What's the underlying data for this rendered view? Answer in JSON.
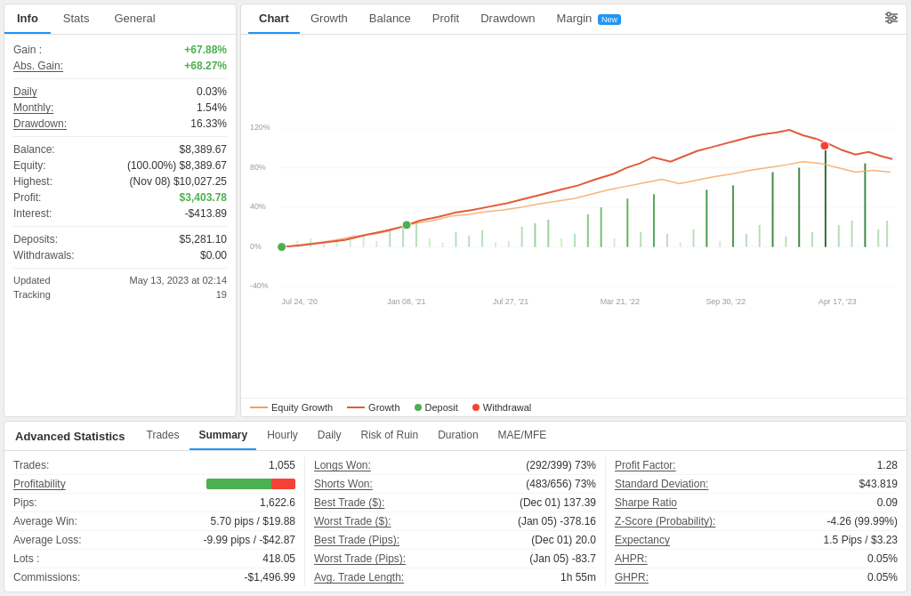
{
  "left": {
    "tabs": [
      "Info",
      "Stats",
      "General"
    ],
    "active_tab": "Info",
    "gain_label": "Gain :",
    "gain_value": "+67.88%",
    "abs_gain_label": "Abs. Gain:",
    "abs_gain_value": "+68.27%",
    "daily_label": "Daily",
    "daily_value": "0.03%",
    "monthly_label": "Monthly:",
    "monthly_value": "1.54%",
    "drawdown_label": "Drawdown:",
    "drawdown_value": "16.33%",
    "balance_label": "Balance:",
    "balance_value": "$8,389.67",
    "equity_label": "Equity:",
    "equity_value": "(100.00%) $8,389.67",
    "highest_label": "Highest:",
    "highest_value": "(Nov 08) $10,027.25",
    "profit_label": "Profit:",
    "profit_value": "$3,403.78",
    "interest_label": "Interest:",
    "interest_value": "-$413.89",
    "deposits_label": "Deposits:",
    "deposits_value": "$5,281.10",
    "withdrawals_label": "Withdrawals:",
    "withdrawals_value": "$0.00",
    "updated_label": "Updated",
    "updated_value": "May 13, 2023 at 02:14",
    "tracking_label": "Tracking",
    "tracking_value": "19"
  },
  "chart": {
    "tabs": [
      "Chart",
      "Growth",
      "Balance",
      "Profit",
      "Drawdown",
      "Margin"
    ],
    "active_tab": "Chart",
    "margin_badge": "New",
    "y_labels": [
      "120%",
      "80%",
      "40%",
      "0%",
      "-40%"
    ],
    "x_labels": [
      "Jul 24, '20",
      "Jan 08, '21",
      "Jul 27, '21",
      "Mar 21, '22",
      "Sep 30, '22",
      "Apr 17, '23"
    ],
    "legend": [
      {
        "label": "Equity Growth",
        "type": "line",
        "color": "#f4a259"
      },
      {
        "label": "Growth",
        "type": "line",
        "color": "#e05c3a"
      },
      {
        "label": "Deposit",
        "type": "dot",
        "color": "#4CAF50"
      },
      {
        "label": "Withdrawal",
        "type": "dot",
        "color": "#f44336"
      }
    ]
  },
  "advanced": {
    "title": "Advanced Statistics",
    "tabs": [
      "Trades",
      "Summary",
      "Hourly",
      "Daily",
      "Risk of Ruin",
      "Duration",
      "MAE/MFE"
    ],
    "active_tab": "Summary",
    "col1": [
      {
        "label": "Trades:",
        "value": "1,055",
        "ul": false
      },
      {
        "label": "Profitability",
        "value": "bar",
        "ul": true
      },
      {
        "label": "Pips:",
        "value": "1,622.6",
        "ul": false
      },
      {
        "label": "Average Win:",
        "value": "5.70 pips / $19.88",
        "ul": false
      },
      {
        "label": "Average Loss:",
        "value": "-9.99 pips / -$42.87",
        "ul": false
      },
      {
        "label": "Lots :",
        "value": "418.05",
        "ul": false
      },
      {
        "label": "Commissions:",
        "value": "-$1,496.99",
        "ul": false
      }
    ],
    "col2": [
      {
        "label": "Longs Won:",
        "value": "(292/399) 73%",
        "ul": true
      },
      {
        "label": "Shorts Won:",
        "value": "(483/656) 73%",
        "ul": true
      },
      {
        "label": "Best Trade ($):",
        "value": "(Dec 01) 137.39",
        "ul": true
      },
      {
        "label": "Worst Trade ($):",
        "value": "(Jan 05) -378.16",
        "ul": true
      },
      {
        "label": "Best Trade (Pips):",
        "value": "(Dec 01) 20.0",
        "ul": true
      },
      {
        "label": "Worst Trade (Pips):",
        "value": "(Jan 05) -83.7",
        "ul": true
      },
      {
        "label": "Avg. Trade Length:",
        "value": "1h 55m",
        "ul": true
      }
    ],
    "col3": [
      {
        "label": "Profit Factor:",
        "value": "1.28",
        "ul": true
      },
      {
        "label": "Standard Deviation:",
        "value": "$43.819",
        "ul": true
      },
      {
        "label": "Sharpe Ratio",
        "value": "0.09",
        "ul": true
      },
      {
        "label": "Z-Score (Probability):",
        "value": "-4.26 (99.99%)",
        "ul": true
      },
      {
        "label": "Expectancy",
        "value": "1.5 Pips / $3.23",
        "ul": true
      },
      {
        "label": "AHPR:",
        "value": "0.05%",
        "ul": true
      },
      {
        "label": "GHPR:",
        "value": "0.05%",
        "ul": true
      }
    ]
  }
}
